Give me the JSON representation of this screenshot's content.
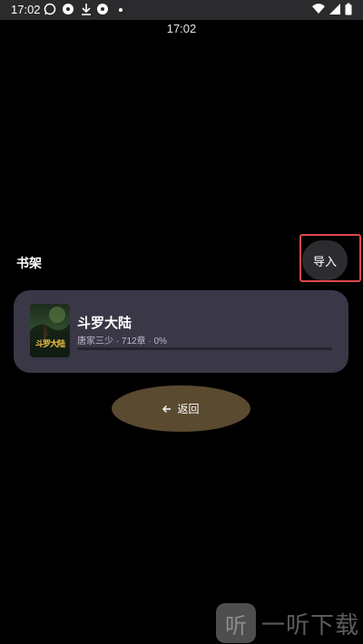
{
  "status_bar": {
    "time": "17:02",
    "icons": [
      "whatsapp-icon",
      "pinwheel-icon",
      "download-icon",
      "pinwheel-icon",
      "dot-icon",
      "wifi-icon",
      "signal-icon",
      "battery-icon"
    ]
  },
  "clock": "17:02",
  "shelf": {
    "title": "书架",
    "import_label": "导入"
  },
  "book": {
    "title": "斗罗大陆",
    "meta": "唐家三少 · 712章 · 0%",
    "cover_text": "斗罗大陆",
    "progress": 0
  },
  "back_label": "返回",
  "watermark": {
    "logo": "听",
    "text": "一听下载"
  },
  "colors": {
    "highlight": "#e0484a",
    "card": "#3a3747",
    "back_button": "#5a4a30"
  }
}
